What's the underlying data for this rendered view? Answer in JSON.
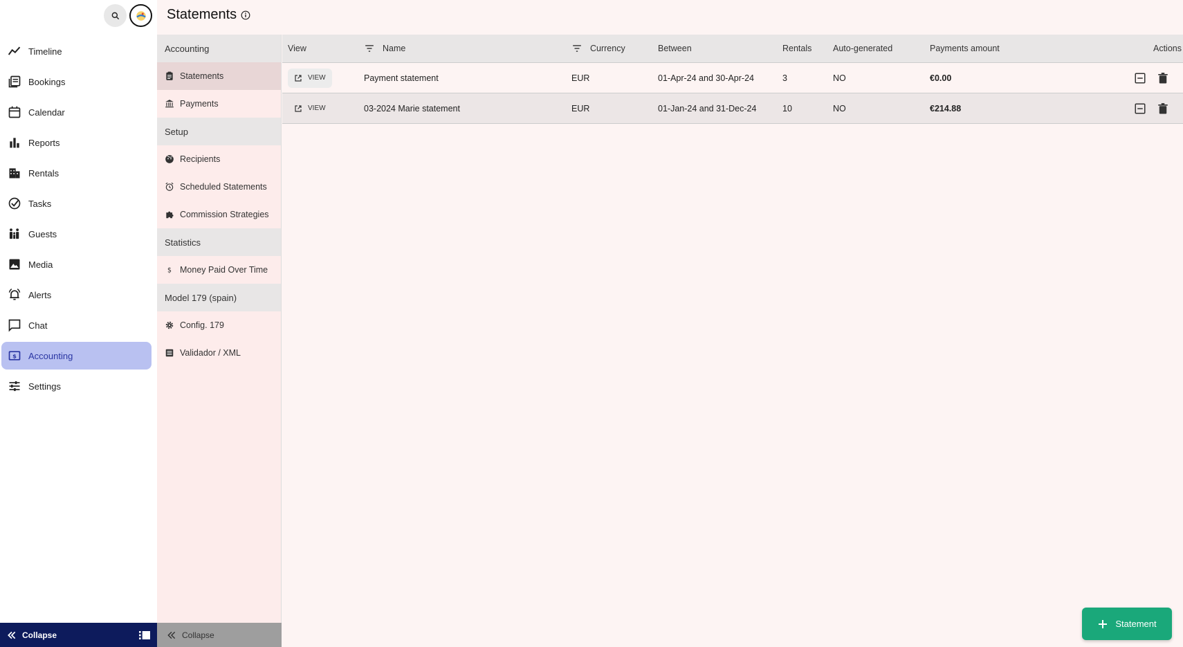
{
  "header": {
    "title": "Statements"
  },
  "sidebar": {
    "items": [
      {
        "label": "Timeline",
        "icon": "timeline-icon"
      },
      {
        "label": "Bookings",
        "icon": "bookings-icon"
      },
      {
        "label": "Calendar",
        "icon": "calendar-icon"
      },
      {
        "label": "Reports",
        "icon": "bar-chart-icon"
      },
      {
        "label": "Rentals",
        "icon": "building-icon"
      },
      {
        "label": "Tasks",
        "icon": "check-circle-icon"
      },
      {
        "label": "Guests",
        "icon": "people-icon"
      },
      {
        "label": "Media",
        "icon": "image-icon"
      },
      {
        "label": "Alerts",
        "icon": "bell-icon"
      },
      {
        "label": "Chat",
        "icon": "chat-icon"
      },
      {
        "label": "Accounting",
        "icon": "dollar-box-icon",
        "active": true
      },
      {
        "label": "Settings",
        "icon": "tune-icon"
      }
    ],
    "collapse_label": "Collapse"
  },
  "subnav": {
    "sections": [
      {
        "title": "Accounting",
        "items": [
          {
            "label": "Statements",
            "active": true
          },
          {
            "label": "Payments"
          }
        ]
      },
      {
        "title": "Setup",
        "items": [
          {
            "label": "Recipients"
          },
          {
            "label": "Scheduled Statements"
          },
          {
            "label": "Commission Strategies"
          }
        ]
      },
      {
        "title": "Statistics",
        "items": [
          {
            "label": "Money Paid Over Time"
          }
        ]
      },
      {
        "title": "Model 179 (spain)",
        "items": [
          {
            "label": "Config. 179"
          },
          {
            "label": "Validador / XML"
          }
        ]
      }
    ],
    "collapse_label": "Collapse"
  },
  "table": {
    "columns": [
      "View",
      "Name",
      "Currency",
      "Between",
      "Rentals",
      "Auto-generated",
      "Payments amount",
      "Actions"
    ],
    "view_label": "VIEW",
    "rows": [
      {
        "name": "Payment statement",
        "currency": "EUR",
        "between": "01-Apr-24 and 30-Apr-24",
        "rentals": "3",
        "auto": "NO",
        "amount": "€0.00"
      },
      {
        "name": "03-2024 Marie statement",
        "currency": "EUR",
        "between": "01-Jan-24 and 31-Dec-24",
        "rentals": "10",
        "auto": "NO",
        "amount": "€214.88"
      }
    ]
  },
  "fab": {
    "label": "Statement"
  },
  "colors": {
    "accent": "#1aa87a",
    "nav_active_bg": "#b9c1f1",
    "sidebar_footer": "#0d1b5c"
  }
}
